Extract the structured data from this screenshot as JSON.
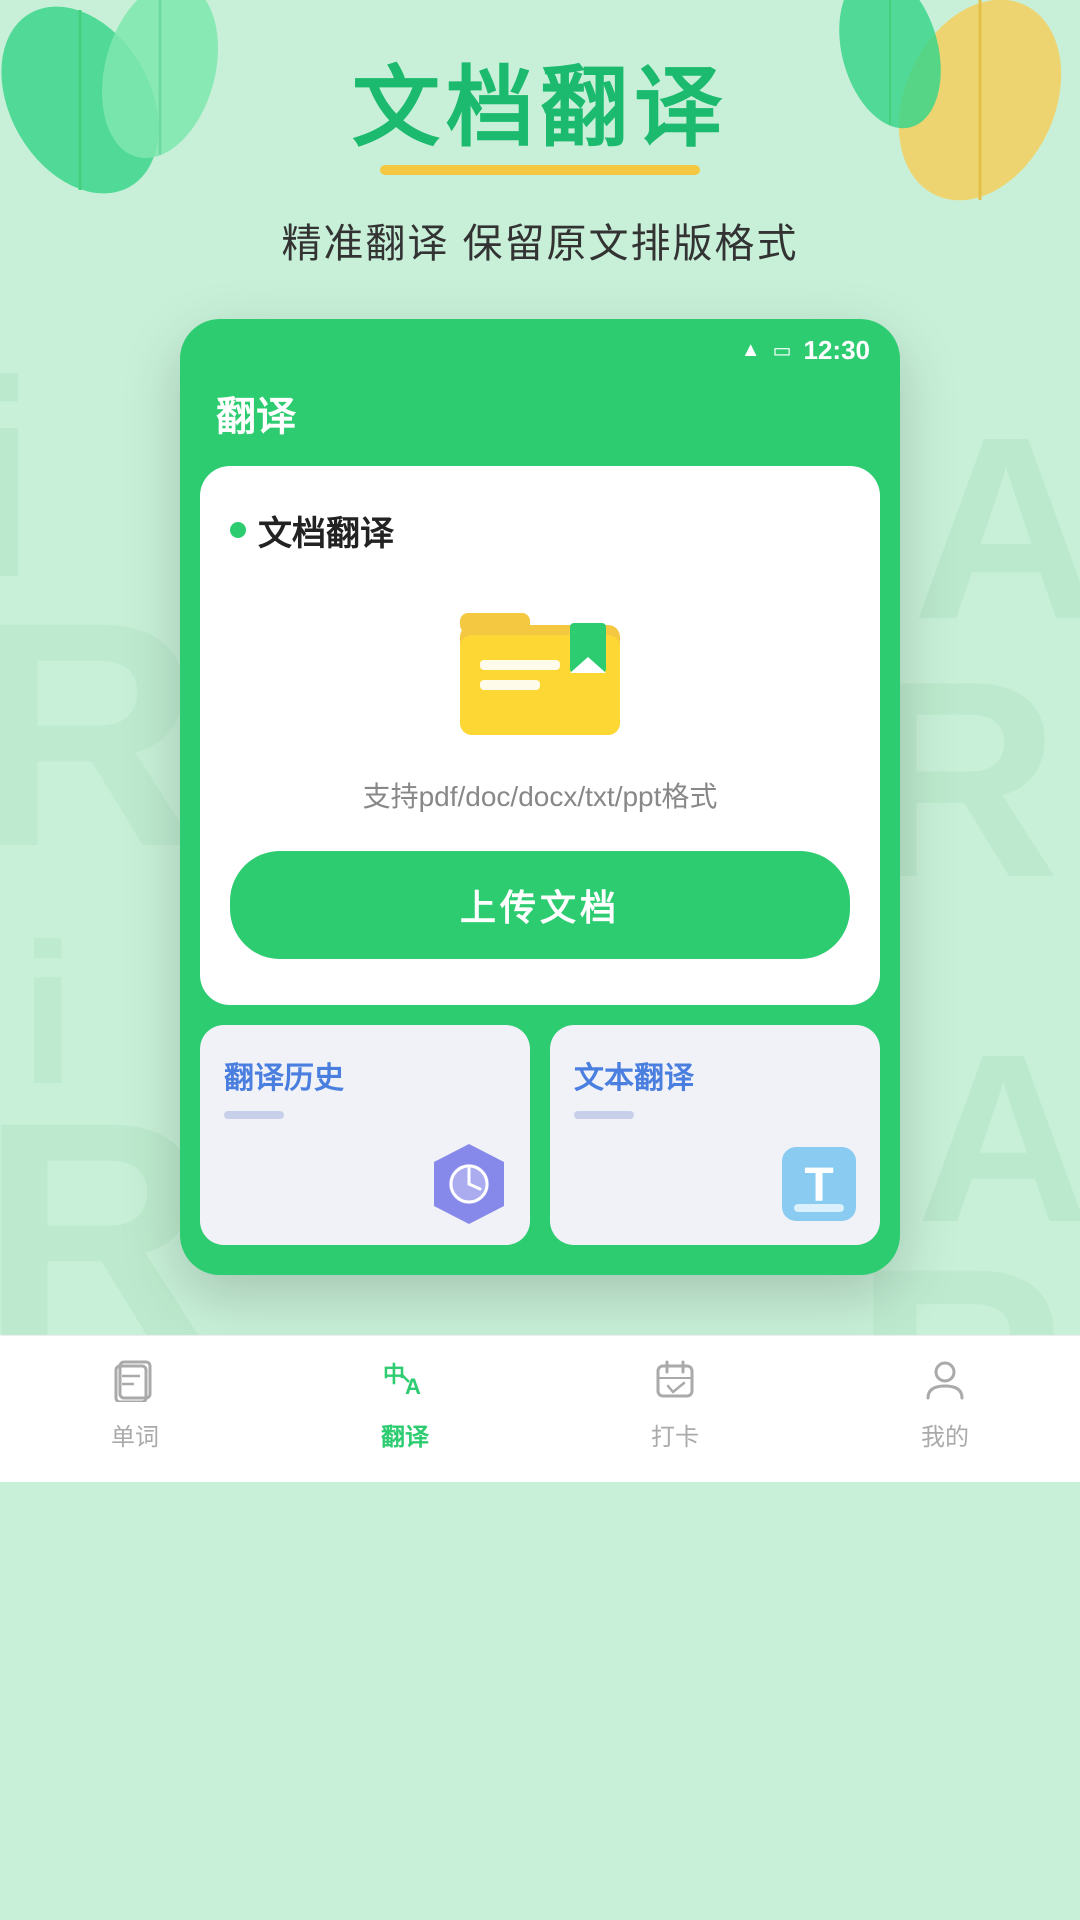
{
  "header": {
    "main_title": "文档翻译",
    "subtitle": "精准翻译 保留原文排版格式"
  },
  "status_bar": {
    "time": "12:30"
  },
  "app": {
    "topbar_title": "翻译",
    "doc_section_label": "文档翻译",
    "file_formats": "支持pdf/doc/docx/txt/ppt格式",
    "upload_btn": "上传文档",
    "green_dot_color": "#2dcc70"
  },
  "mini_cards": [
    {
      "title": "翻译历史",
      "icon_type": "history"
    },
    {
      "title": "文本翻译",
      "icon_type": "text"
    }
  ],
  "bottom_nav": {
    "items": [
      {
        "label": "单词",
        "icon": "card",
        "active": false
      },
      {
        "label": "翻译",
        "icon": "translate",
        "active": true
      },
      {
        "label": "打卡",
        "icon": "calendar",
        "active": false
      },
      {
        "label": "我的",
        "icon": "person",
        "active": false
      }
    ]
  },
  "colors": {
    "green_primary": "#2dcc70",
    "yellow_accent": "#f5c842",
    "blue_accent": "#4a7fe0",
    "light_bg": "#c8f0d8"
  }
}
